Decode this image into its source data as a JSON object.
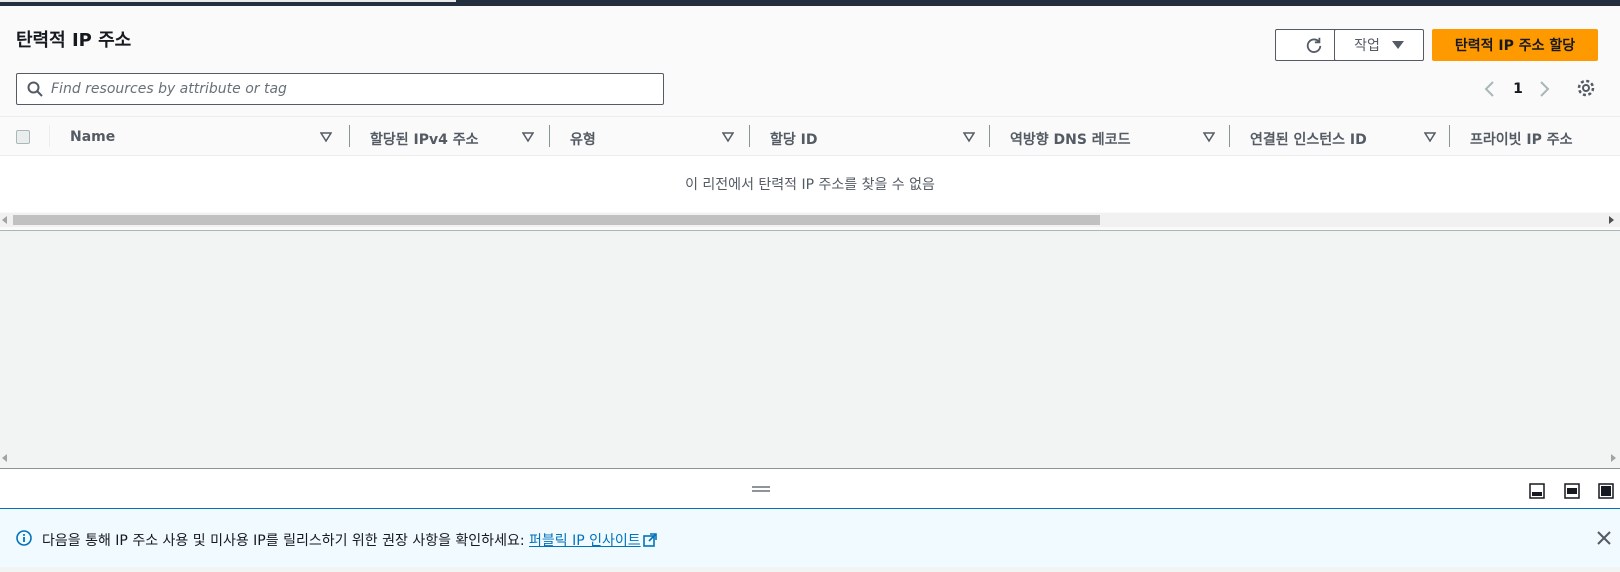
{
  "top_bar": {
    "accent": "#232f3e"
  },
  "panel": {
    "title": "탄력적 IP 주소",
    "refresh_icon": "refresh-icon",
    "actions_label": "작업",
    "allocate_label": "탄력적 IP 주소 할당",
    "allocate_color": "#ff9900",
    "search": {
      "placeholder": "Find resources by attribute or tag",
      "value": ""
    },
    "pagination": {
      "current_page": "1"
    }
  },
  "table": {
    "columns": [
      {
        "label": "Name"
      },
      {
        "label": "할당된 IPv4 주소"
      },
      {
        "label": "유형"
      },
      {
        "label": "할당 ID"
      },
      {
        "label": "역방향 DNS 레코드"
      },
      {
        "label": "연결된 인스턴스 ID"
      },
      {
        "label": "프라이빗 IP 주소"
      }
    ],
    "empty_message": "이 리전에서 탄력적 IP 주소를 찾을 수 없음"
  },
  "info_bar": {
    "text": "다음을 통해 IP 주소 사용 및 미사용 IP를 릴리스하기 위한 권장 사항을 확인하세요: ",
    "link": "퍼블릭 IP 인사이트",
    "link_color": "#0073bb"
  }
}
